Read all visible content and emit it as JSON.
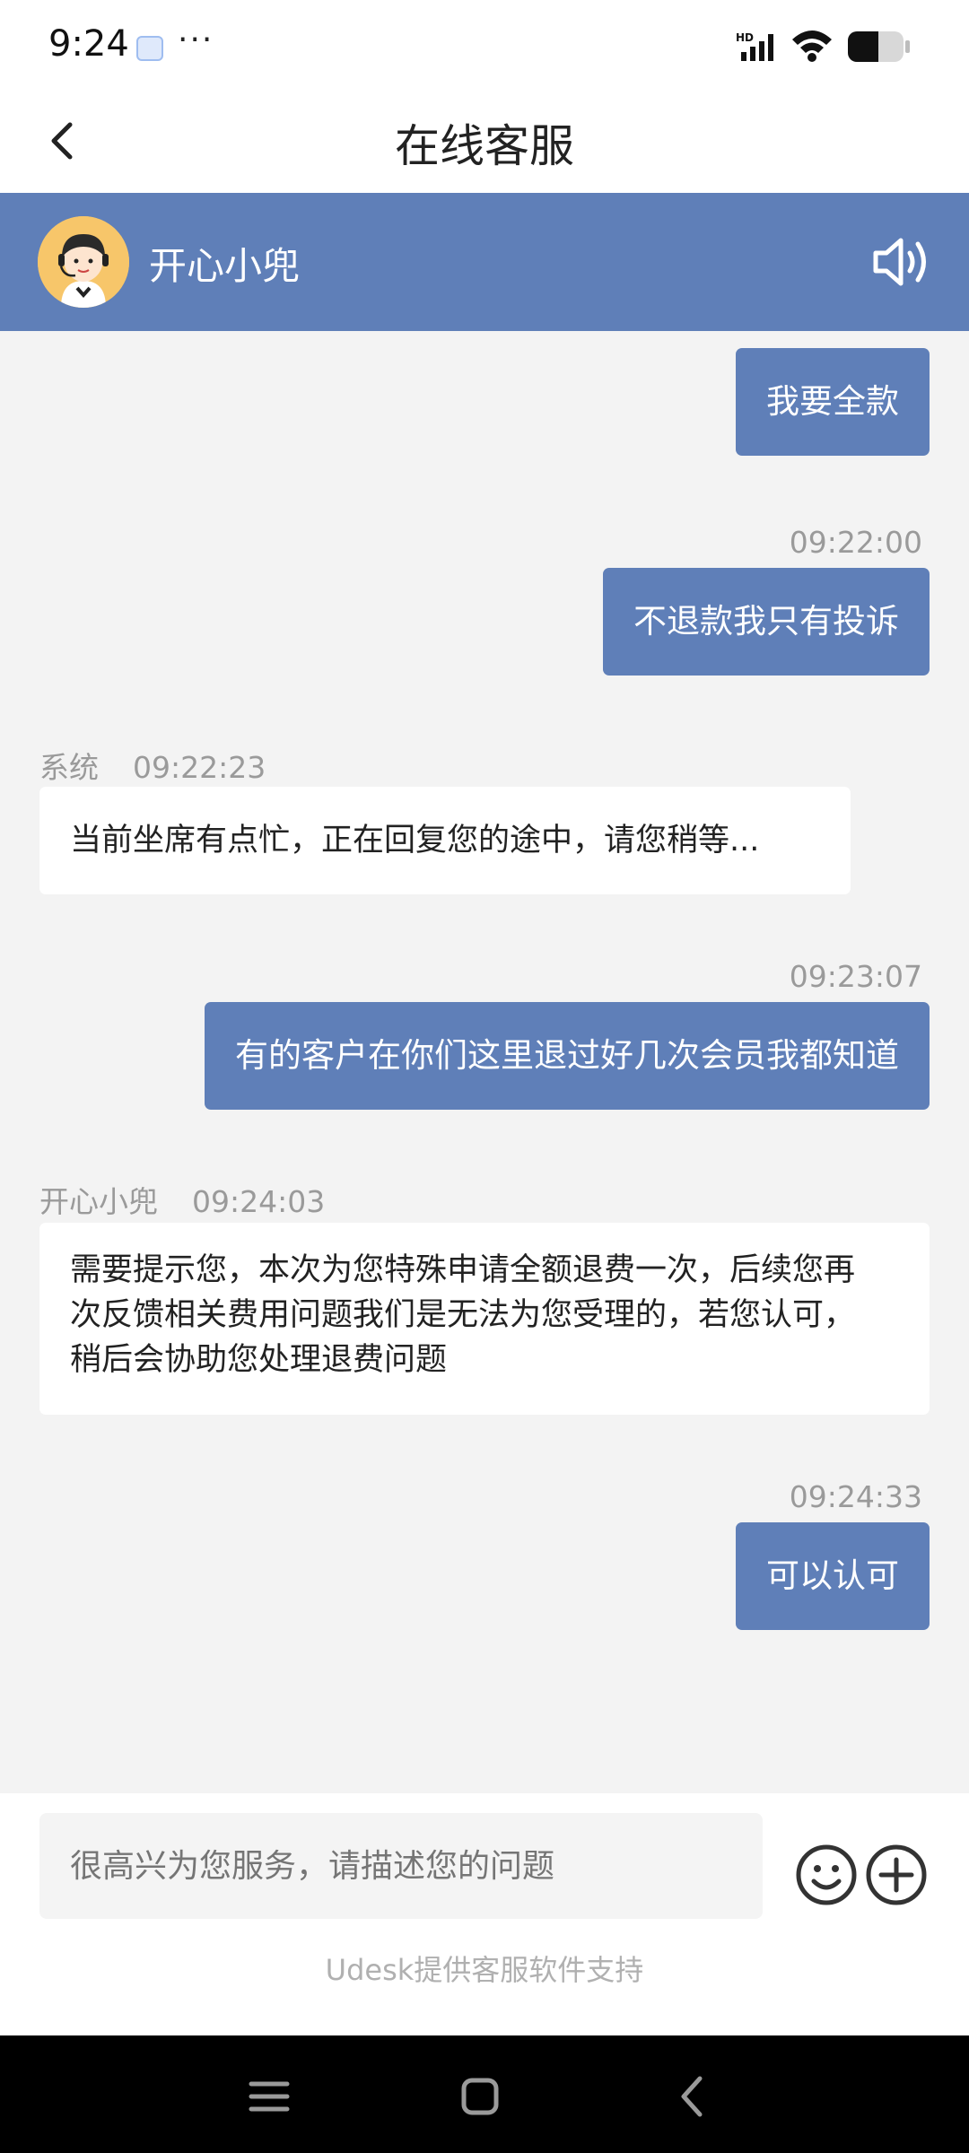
{
  "status_bar": {
    "time": "9:24",
    "more": "···",
    "network": "HD"
  },
  "nav": {
    "title": "在线客服"
  },
  "agent": {
    "name": "开心小兜"
  },
  "messages": [
    {
      "text": "我要全款"
    },
    {
      "time": "09:22:00",
      "text": "不退款我只有投诉"
    },
    {
      "sender": "系统",
      "time": "09:22:23",
      "text": "当前坐席有点忙，正在回复您的途中，请您稍等..."
    },
    {
      "time": "09:23:07",
      "text": "有的客户在你们这里退过好几次会员我都知道"
    },
    {
      "sender": "开心小兜",
      "time": "09:24:03",
      "lines": [
        "需要提示您，本次为您特殊申请全额退费一次，后续您再",
        "次反馈相关费用问题我们是无法为您受理的，若您认可，",
        "稍后会协助您处理退费问题"
      ]
    },
    {
      "time": "09:24:33",
      "text": "可以认可"
    }
  ],
  "input": {
    "placeholder": "很高兴为您服务，请描述您的问题"
  },
  "footer": {
    "support": "Udesk提供客服软件支持"
  },
  "colors": {
    "accent": "#5f7fb8",
    "background": "#f3f3f3"
  }
}
